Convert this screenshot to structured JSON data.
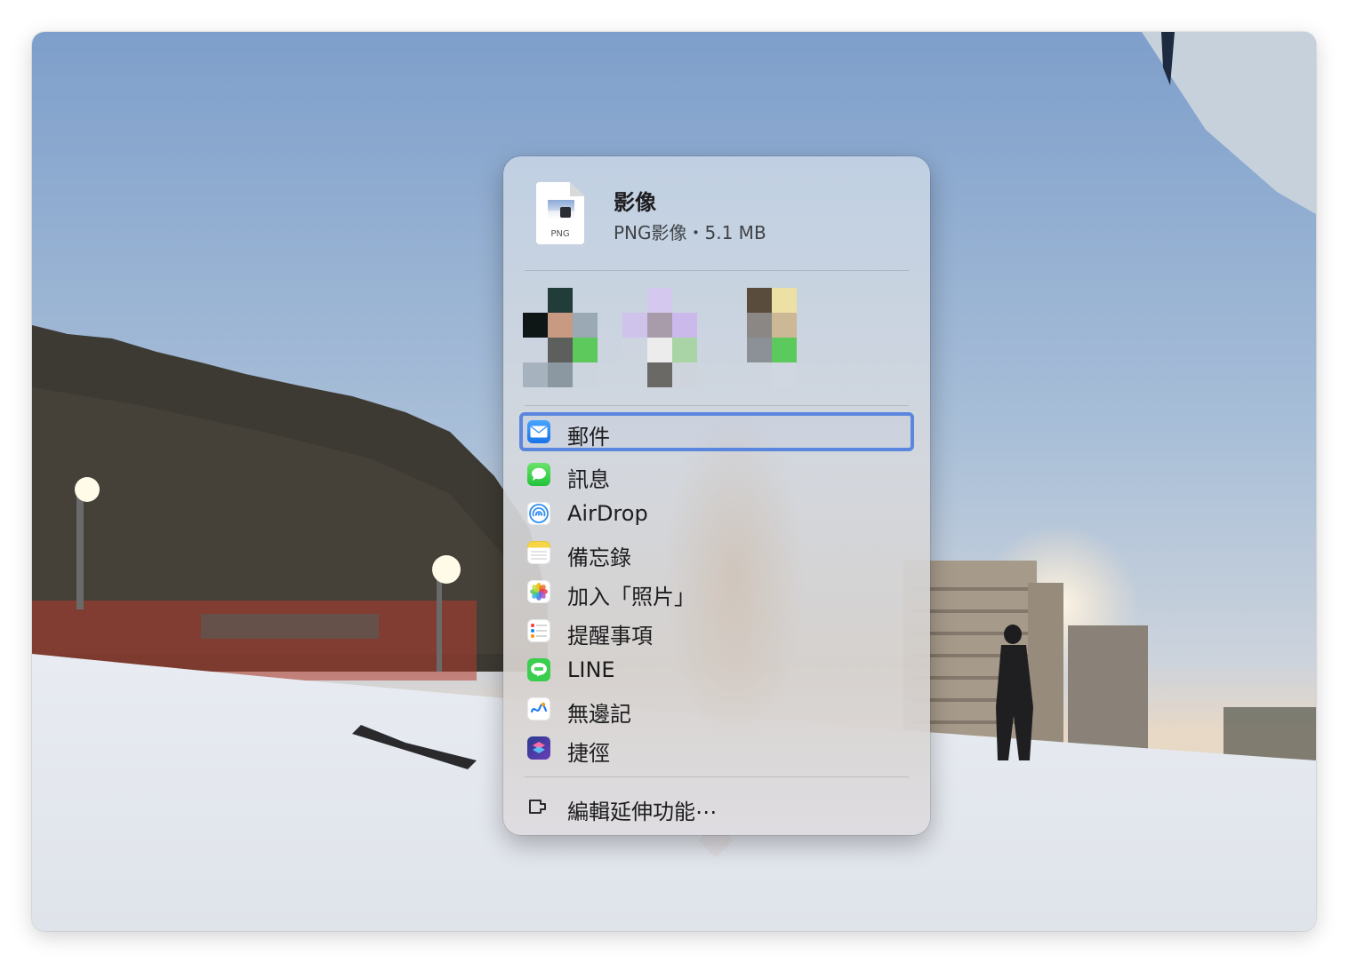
{
  "file": {
    "name": "影像",
    "meta": "PNG影像・5.1 MB",
    "extension_badge": "PNG",
    "icon": "png-file-icon"
  },
  "share_menu": {
    "items": [
      {
        "label": "郵件",
        "icon": "mail-app-icon",
        "selected": true
      },
      {
        "label": "訊息",
        "icon": "messages-app-icon"
      },
      {
        "label": "AirDrop",
        "icon": "airdrop-icon"
      },
      {
        "label": "備忘錄",
        "icon": "notes-app-icon"
      },
      {
        "label": "加入「照片」",
        "icon": "photos-app-icon"
      },
      {
        "label": "提醒事項",
        "icon": "reminders-app-icon"
      },
      {
        "label": "LINE",
        "icon": "line-app-icon"
      },
      {
        "label": "無邊記",
        "icon": "freeform-app-icon"
      },
      {
        "label": "捷徑",
        "icon": "shortcuts-app-icon"
      }
    ],
    "edit_extensions": "編輯延伸功能⋯"
  },
  "colors": {
    "selection_border": "#5b86dd",
    "popover_background": "#d7dae0"
  }
}
